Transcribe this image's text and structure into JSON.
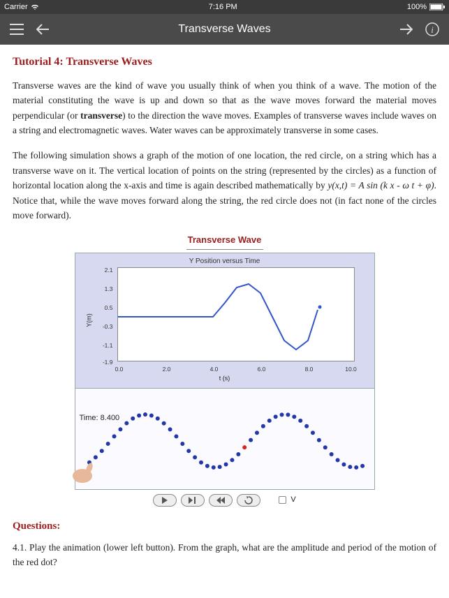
{
  "status": {
    "carrier": "Carrier",
    "time": "7:16 PM",
    "battery": "100%"
  },
  "nav": {
    "title": "Transverse Waves"
  },
  "tutorial": {
    "heading": "Tutorial 4: Transverse Waves",
    "para1_a": "Transverse waves are the kind of wave you usually think of when you think of a wave. The motion of the material constituting the wave is up and down so that as the wave moves forward the material moves perpendicular (or ",
    "para1_bold": "transverse",
    "para1_b": ") to the direction the wave moves. Examples of transverse waves include waves on a string and electromagnetic waves. Water waves can be approximately transverse in some cases.",
    "para2_a": "The following simulation shows a graph of the motion of one location, the red circle, on a string which has a transverse wave on it. The vertical location of points on the string (represented by the circles) as a function of horizontal location along the x-axis and time is again described mathematically by ",
    "para2_eq1": "y(x,t) = A sin (k x - ω t + φ)",
    "para2_b": ". Notice that, while the wave moves forward along the string, the red circle does not (in fact none of the circles move forward)."
  },
  "simulation": {
    "title": "Transverse Wave",
    "chart_title": "Y Position versus Time",
    "ylabel": "Y(m)",
    "xlabel": "t (s)",
    "time_label": "Time: 8.400",
    "v_label": "V"
  },
  "chart_data": {
    "type": "line",
    "title": "Y Position versus Time",
    "xlabel": "t (s)",
    "ylabel": "Y(m)",
    "xlim": [
      0,
      10
    ],
    "ylim": [
      -1.9,
      2.1
    ],
    "xticks": [
      0.0,
      2.0,
      4.0,
      6.0,
      8.0,
      10.0
    ],
    "yticks": [
      -1.9,
      -1.1,
      -0.3,
      0.5,
      1.3,
      2.1
    ],
    "series": [
      {
        "name": "Y position",
        "x": [
          0.0,
          0.5,
          1.0,
          1.5,
          2.0,
          2.5,
          3.0,
          3.5,
          4.0,
          4.5,
          5.0,
          5.5,
          6.0,
          6.5,
          7.0,
          7.5,
          8.0,
          8.4
        ],
        "y": [
          0.0,
          0.0,
          0.0,
          0.0,
          0.0,
          0.0,
          0.0,
          0.0,
          0.0,
          0.6,
          1.1,
          1.3,
          0.9,
          0.0,
          -0.9,
          -1.3,
          -0.6,
          0.3
        ]
      }
    ],
    "string_points": {
      "description": "circles on string at t=8.4s forming sine wave, one red marker near center",
      "count": 45,
      "red_index": 25
    }
  },
  "questions": {
    "heading": "Questions:",
    "q1": "4.1. Play the animation (lower left button). From the graph, what are the amplitude and period of the motion of the red dot?"
  }
}
